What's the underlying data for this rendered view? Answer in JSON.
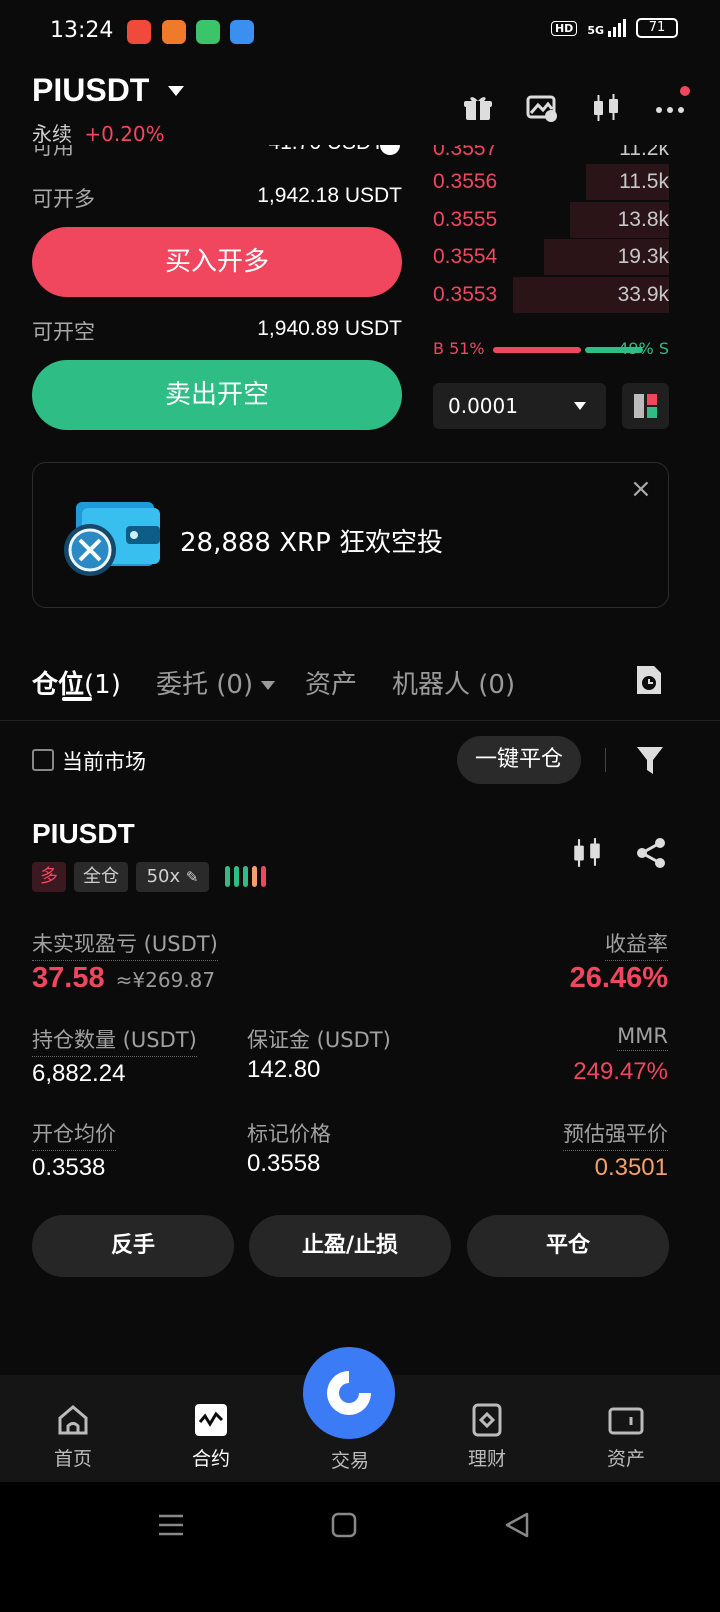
{
  "status_bar": {
    "time": "13:24",
    "hd": "HD",
    "network": "5G",
    "battery": "71"
  },
  "header": {
    "symbol": "PIUSDT",
    "contract_type": "永续",
    "change": "+0.20%"
  },
  "form": {
    "available_label": "可用",
    "available_value": "41.76 USDT",
    "can_long_label": "可开多",
    "can_long_value": "1,942.18 USDT",
    "buy_button": "买入开多",
    "can_short_label": "可开空",
    "can_short_value": "1,940.89 USDT",
    "sell_button": "卖出开空"
  },
  "orderbook": {
    "partial_top": {
      "price": "0.3557",
      "size": "11.2k"
    },
    "asks": [
      {
        "price": "0.3556",
        "size": "11.5k",
        "depth": 0.35
      },
      {
        "price": "0.3555",
        "size": "13.8k",
        "depth": 0.42
      },
      {
        "price": "0.3554",
        "size": "19.3k",
        "depth": 0.53
      },
      {
        "price": "0.3553",
        "size": "33.9k",
        "depth": 0.66
      }
    ],
    "buy_ratio": "B 51%",
    "sell_ratio": "49% S",
    "precision": "0.0001"
  },
  "banner": {
    "text": "28,888 XRP 狂欢空投",
    "close": "×"
  },
  "tabs": [
    {
      "label": "仓位",
      "count": "(1)"
    },
    {
      "label": "委托",
      "count": "(0)"
    },
    {
      "label": "资产",
      "count": ""
    },
    {
      "label": "机器人",
      "count": "(0)"
    }
  ],
  "filter": {
    "current_market": "当前市场",
    "close_all": "一键平仓"
  },
  "position": {
    "symbol": "PIUSDT",
    "side": "多",
    "margin_mode": "全仓",
    "leverage": "50x",
    "unrealized_pnl_label": "未实现盈亏 (USDT)",
    "unrealized_pnl": "37.58",
    "unrealized_pnl_cny": "≈¥269.87",
    "roe_label": "收益率",
    "roe": "26.46%",
    "size_label": "持仓数量 (USDT)",
    "size": "6,882.24",
    "margin_label": "保证金 (USDT)",
    "margin": "142.80",
    "mmr_label": "MMR",
    "mmr": "249.47%",
    "entry_label": "开仓均价",
    "entry": "0.3538",
    "mark_label": "标记价格",
    "mark": "0.3558",
    "liq_label": "预估强平价",
    "liq": "0.3501"
  },
  "actions": {
    "reverse": "反手",
    "tpsl": "止盈/止损",
    "close": "平仓"
  },
  "nav": {
    "home": "首页",
    "contract": "合约",
    "trade": "交易",
    "earn": "理财",
    "assets": "资产"
  },
  "colors": {
    "red": "#f0475f",
    "green": "#2ebd85",
    "orange": "#f5a06a",
    "blue": "#3b7bf6"
  }
}
